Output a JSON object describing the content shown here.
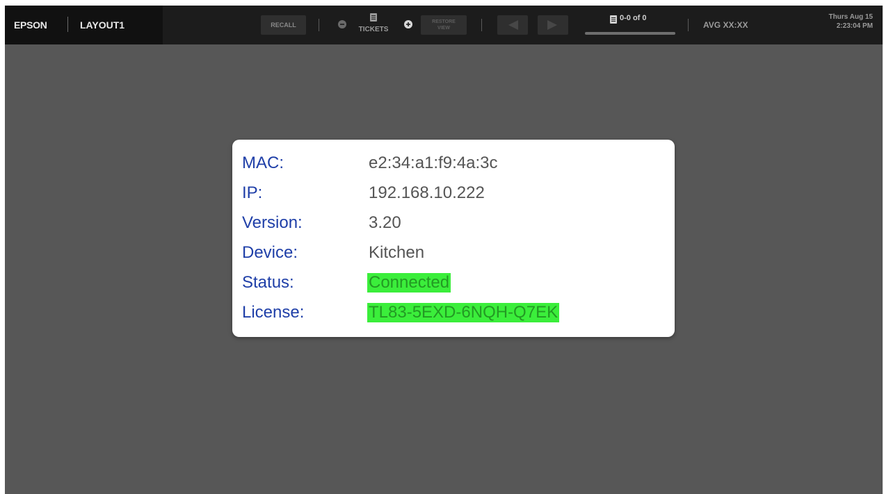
{
  "topbar": {
    "brand": "EPSON",
    "layout_name": "LAYOUT1",
    "recall_label": "RECALL",
    "tickets_label": "TICKETS",
    "restore_label_line1": "RESTORE",
    "restore_label_line2": "VIEW",
    "counter_label": "0-0 of 0",
    "avg_label": "AVG XX:XX",
    "date": "Thurs Aug 15",
    "time": "2:23:04 PM",
    "icons": [
      "ticket-icon",
      "minus-circle-icon",
      "plus-circle-icon",
      "arrow-left-icon",
      "arrow-right-icon"
    ]
  },
  "info": {
    "rows": [
      {
        "label": "MAC:",
        "value": "e2:34:a1:f9:4a:3c"
      },
      {
        "label": "IP:",
        "value": "192.168.10.222"
      },
      {
        "label": "Version:",
        "value": "3.20"
      },
      {
        "label": "Device:",
        "value": "Kitchen"
      },
      {
        "label": "Status:",
        "value": "Connected"
      },
      {
        "label": "License:",
        "value": "TL83-5EXD-6NQH-Q7EK"
      }
    ]
  },
  "colors": {
    "label": "#1f3fa8",
    "value": "#555555",
    "highlight_bg": "#3bee3b",
    "highlight_text": "#239a23",
    "background": "#575757",
    "topbar": "#1c1c1c"
  }
}
